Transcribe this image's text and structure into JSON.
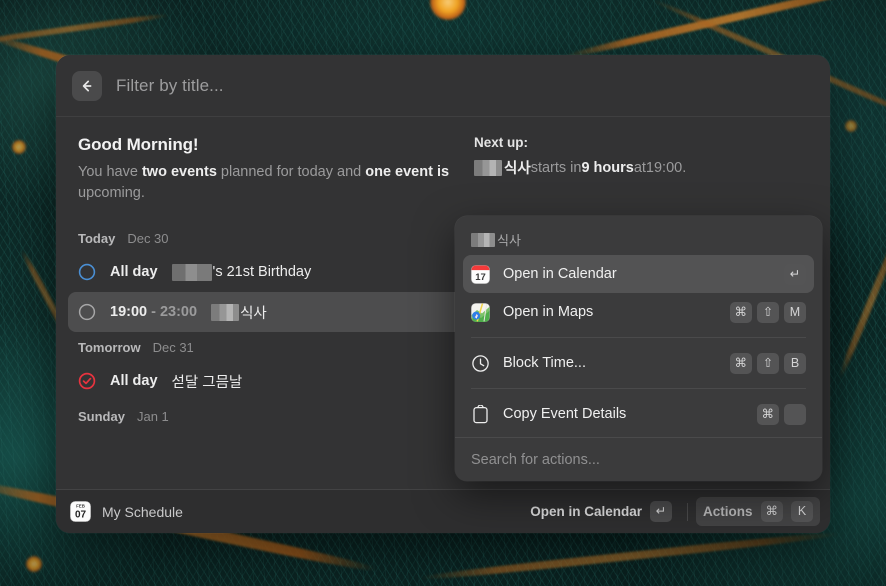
{
  "window": {
    "search": {
      "placeholder": "Filter by title...",
      "value": "",
      "back_icon": "arrow-left-icon"
    },
    "greeting": {
      "title": "Good Morning!",
      "line_prefix": "You have ",
      "bold_1": "two events",
      "line_mid": " planned for today and ",
      "bold_2": "one event is",
      "line_suffix": " upcoming."
    },
    "next_up": {
      "heading": "Next up:",
      "redacted": "",
      "title": "식사",
      "mid": " starts in ",
      "duration": "9 hours",
      "at": " at ",
      "time": "19:00."
    },
    "sections": [
      {
        "day": "Today",
        "date": "Dec 30",
        "events": [
          {
            "bullet": "circle-outline-blue-icon",
            "time": "All day",
            "time_dim": "",
            "redacted": "",
            "title": "'s 21st Birthday",
            "selected": false
          },
          {
            "bullet": "circle-outline-gray-icon",
            "time": "19:00",
            "time_dim": " - 23:00",
            "redacted": "",
            "title": "식사",
            "selected": true
          }
        ]
      },
      {
        "day": "Tomorrow",
        "date": "Dec 31",
        "events": [
          {
            "bullet": "check-circle-red-icon",
            "time": "All day",
            "time_dim": "",
            "redacted": null,
            "title": "섣달 그믐날",
            "selected": false
          }
        ]
      },
      {
        "day": "Sunday",
        "date": "Jan 1",
        "events": []
      }
    ],
    "footer": {
      "app_icon": "calendar-app-icon",
      "app_icon_month": "FEB",
      "app_icon_day": "07",
      "app_name": "My Schedule",
      "primary_action": "Open in Calendar",
      "primary_key": "↵",
      "actions_label": "Actions",
      "actions_keys": [
        "⌘",
        "K"
      ]
    }
  },
  "popup": {
    "header": {
      "redacted": "",
      "title": "식사"
    },
    "items": [
      {
        "icon": "calendar-17-icon",
        "label": "Open in Calendar",
        "keys": [
          "↵"
        ],
        "active": true,
        "separator_after": false
      },
      {
        "icon": "maps-icon",
        "label": "Open in Maps",
        "keys": [
          "⌘",
          "⇧",
          "M"
        ],
        "active": false,
        "separator_after": true
      },
      {
        "icon": "clock-icon",
        "label": "Block Time...",
        "keys": [
          "⌘",
          "⇧",
          "B"
        ],
        "active": false,
        "separator_after": true
      },
      {
        "icon": "clipboard-icon",
        "label": "Copy Event Details",
        "keys": [
          "⌘",
          ""
        ],
        "active": false,
        "separator_after": false
      }
    ],
    "search_placeholder": "Search for actions..."
  },
  "colors": {
    "panel": "#333334",
    "popup": "#3b3b3c",
    "accent_blue": "#4a8fd4",
    "accent_red": "#e8333f",
    "selected_row": "#4d4d4e"
  }
}
